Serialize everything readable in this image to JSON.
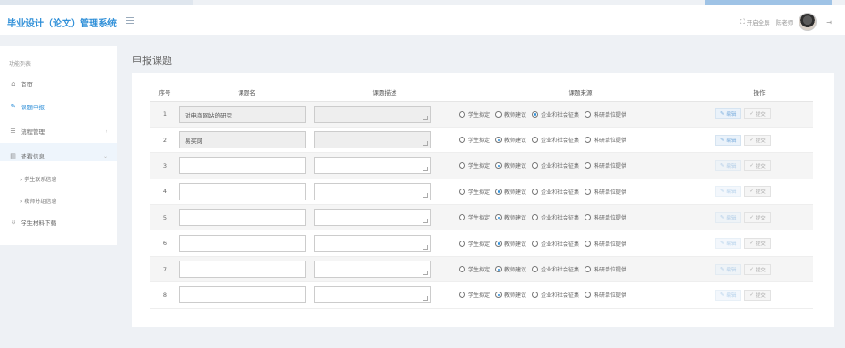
{
  "app": {
    "title": "毕业设计（论文）管理系统"
  },
  "header": {
    "fullscreen_label": "开启全屏",
    "user_name": "陈老师"
  },
  "sidebar": {
    "title": "功能列表",
    "items": [
      {
        "label": "首页",
        "icon": "home-icon"
      },
      {
        "label": "课题申报",
        "icon": "edit-icon"
      },
      {
        "label": "流程管理",
        "icon": "list-icon"
      },
      {
        "label": "查看信息",
        "icon": "calendar-icon"
      },
      {
        "label": "学生联系信息",
        "icon": "chevron-right-icon"
      },
      {
        "label": "教师分组信息",
        "icon": "chevron-right-icon"
      },
      {
        "label": "学生材料下载",
        "icon": "download-icon"
      }
    ]
  },
  "page": {
    "title": "申报课题"
  },
  "table": {
    "headers": [
      "序号",
      "课题名",
      "课题描述",
      "课题来源",
      "操作"
    ],
    "source_options": [
      "学生拟定",
      "教师建议",
      "企业和社会征集",
      "科研单位提供"
    ],
    "edit_label": "编辑",
    "submit_label": "提交",
    "rows": [
      {
        "no": "1",
        "name": "对电商网站的研究",
        "desc": "",
        "source": "企业和社会征集"
      },
      {
        "no": "2",
        "name": "易买网",
        "desc": "",
        "source": "教师建议"
      },
      {
        "no": "3",
        "name": "",
        "desc": "",
        "source": "教师建议"
      },
      {
        "no": "4",
        "name": "",
        "desc": "",
        "source": "教师建议"
      },
      {
        "no": "5",
        "name": "",
        "desc": "",
        "source": "教师建议"
      },
      {
        "no": "6",
        "name": "",
        "desc": "",
        "source": "教师建议"
      },
      {
        "no": "7",
        "name": "",
        "desc": "",
        "source": "教师建议"
      },
      {
        "no": "8",
        "name": "",
        "desc": "",
        "source": "教师建议"
      }
    ]
  },
  "colors": {
    "accent": "#2f8fd8",
    "background": "#eef1f5"
  }
}
